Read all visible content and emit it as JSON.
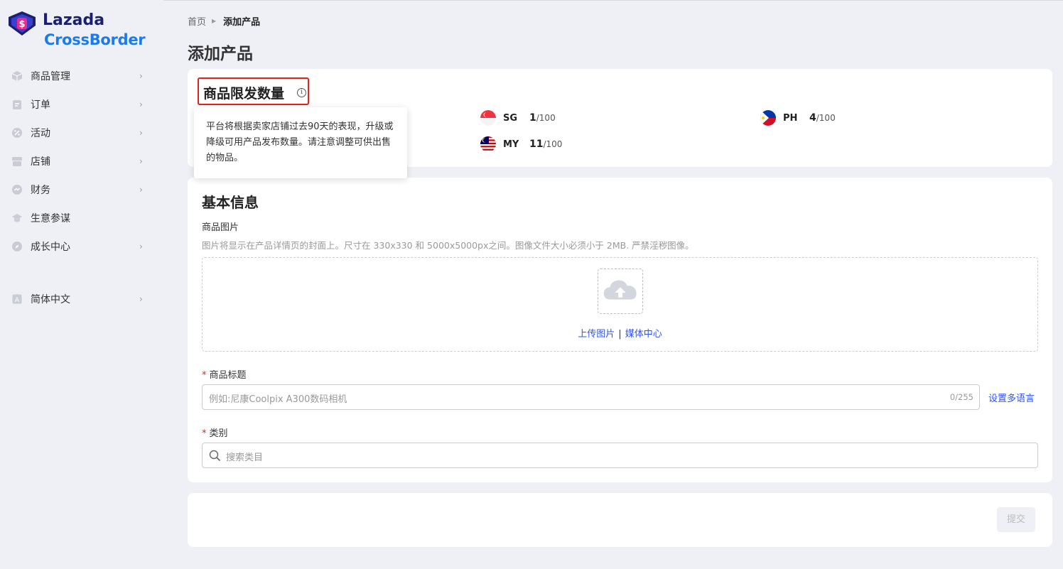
{
  "brand": {
    "line1": "Lazada",
    "line2": "CrossBorder",
    "accent": "#1a7bea",
    "navy": "#1a1f71"
  },
  "sidebar": {
    "items": [
      {
        "label": "商品管理",
        "icon": "box-icon",
        "chevron": "›"
      },
      {
        "label": "订单",
        "icon": "order-icon",
        "chevron": "›"
      },
      {
        "label": "活动",
        "icon": "promotion-icon",
        "chevron": "›"
      },
      {
        "label": "店铺",
        "icon": "store-icon",
        "chevron": "›"
      },
      {
        "label": "财务",
        "icon": "finance-icon",
        "chevron": "›"
      },
      {
        "label": "生意参谋",
        "icon": "graduation-cap-icon"
      },
      {
        "label": "成长中心",
        "icon": "compass-icon",
        "chevron": "›"
      }
    ],
    "language": {
      "label": "简体中文",
      "icon": "language-icon",
      "chevron": "›"
    }
  },
  "breadcrumb": {
    "home": "首页",
    "sep": "▶",
    "current": "添加产品"
  },
  "page_title": "添加产品",
  "quota": {
    "title": "商品限发数量",
    "info_glyph": "i",
    "tooltip": "平台将根据卖家店铺过去90天的表现，升级或降级可用产品发布数量。请注意调整可供出售的物品。",
    "countries": [
      {
        "code": "SG",
        "used": "1",
        "max": "/100"
      },
      {
        "code": "PH",
        "used": "4",
        "max": "/100"
      },
      {
        "code": "MY",
        "used": "11",
        "max": "/100"
      }
    ]
  },
  "basic": {
    "title": "基本信息",
    "image_label": "商品图片",
    "image_desc": "图片将显示在产品详情页的封面上。尺寸在 330x330 和 5000x5000px之间。图像文件大小必须小于 2MB. 严禁淫秽图像。",
    "upload_link": "上传图片",
    "upload_sep": "|",
    "media_link": "媒体中心",
    "required_mark": "*",
    "title_label": "商品标题",
    "title_placeholder": "例如:尼康Coolpix A300数码相机",
    "title_count": "0/255",
    "multi_lang": "设置多语言",
    "category_label": "类别",
    "category_placeholder": "搜索类目"
  },
  "footer": {
    "submit": "提交"
  }
}
